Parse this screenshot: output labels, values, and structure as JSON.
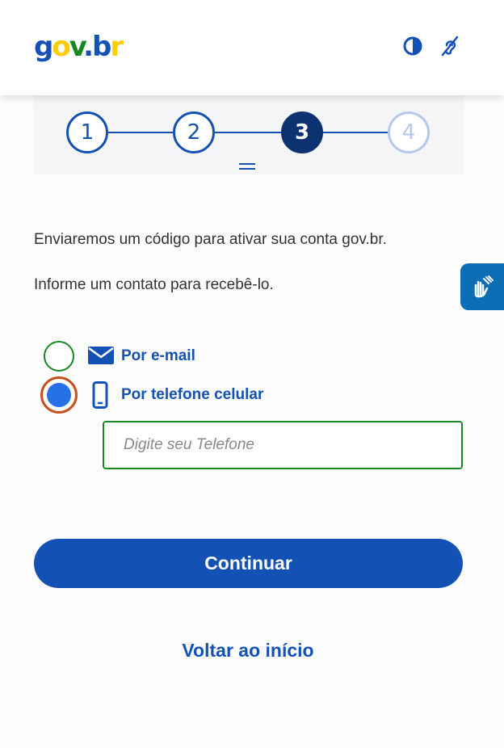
{
  "header": {
    "logo": {
      "g": "g",
      "o": "o",
      "v": "v",
      "dot": ".",
      "b": "b",
      "r": "r"
    },
    "icons": [
      "contrast-icon",
      "hearing-icon"
    ]
  },
  "stepper": {
    "steps": [
      "1",
      "2",
      "3",
      "4"
    ],
    "current_step": 3
  },
  "content": {
    "line1": "Enviaremos um código para ativar sua conta gov.br.",
    "line2": "Informe um contato para recebê-lo."
  },
  "options": {
    "email_label": "Por e-mail",
    "phone_label": "Por telefone celular",
    "selected": "phone"
  },
  "phone_field": {
    "placeholder": "Digite seu Telefone",
    "value": ""
  },
  "actions": {
    "continue_label": "Continuar",
    "back_label": "Voltar ao início"
  },
  "colors": {
    "primary": "#1351b4",
    "step_active": "#0c326f",
    "success_border": "#168821",
    "focus_ring": "#c8501e",
    "radio_fill": "#2670e8",
    "libras": "#0b6eb5"
  },
  "side_widget": {
    "icon": "sign-language-icon"
  }
}
